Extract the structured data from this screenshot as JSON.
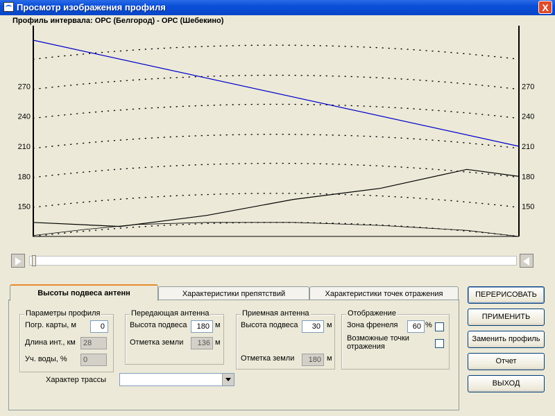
{
  "window": {
    "title": "Просмотр изображения профиля",
    "close_label": "X"
  },
  "profile_title": "Профиль интервала: ОРС (Белгород) - ОРС (Шебекино)",
  "chart_data": {
    "type": "line",
    "title": "Профиль интервала: ОРС (Белгород) - ОРС (Шебекино)",
    "xlabel": "",
    "ylabel": "",
    "xlim": [
      0,
      28
    ],
    "ylim": [
      120,
      325
    ],
    "x_ticks": [
      2,
      4,
      6,
      8,
      10,
      12,
      14,
      16,
      18,
      20,
      22,
      24,
      26
    ],
    "y_ticks": [
      150,
      180,
      210,
      240,
      270
    ],
    "series": [
      {
        "line_color": "#0000cc",
        "x": [
          0,
          28
        ],
        "y": [
          316,
          210
        ]
      },
      {
        "line_color": "#000000",
        "x": [
          0,
          5,
          10,
          15,
          20,
          25,
          28
        ],
        "y": [
          134,
          130,
          141,
          157,
          168,
          187,
          180
        ]
      },
      {
        "line_color": "#000000",
        "x": [
          0,
          3,
          6,
          10,
          15,
          20,
          25,
          28
        ],
        "y": [
          121,
          127,
          132,
          134,
          134,
          131,
          126,
          120
        ]
      }
    ],
    "earth_curve_offsets": [
      0,
      29,
      59,
      88,
      118,
      147,
      177
    ],
    "grid": "dotted"
  },
  "tabs": [
    {
      "label": "Высоты подвеса антенн",
      "active": true
    },
    {
      "label": "Характеристики препятствий",
      "active": false
    },
    {
      "label": "Характеристики точек отражения",
      "active": false
    }
  ],
  "profile_params": {
    "group_title": "Параметры профиля",
    "map_error_label": "Погр. карты, м",
    "map_error_value": "0",
    "length_label": "Длина инт., км",
    "length_value": "28",
    "water_label": "Уч. воды, %",
    "water_value": "0"
  },
  "tx_antenna": {
    "group_title": "Передающая антенна",
    "height_label": "Высота подвеса",
    "height_value": "180",
    "height_unit": "м",
    "ground_label": "Отметка земли",
    "ground_value": "136",
    "ground_unit": "м"
  },
  "rx_antenna": {
    "group_title": "Приемная антенна",
    "height_label": "Высота подвеса",
    "height_value": "30",
    "height_unit": "м",
    "ground_label": "Отметка земли",
    "ground_value": "180",
    "ground_unit": "м"
  },
  "display": {
    "group_title": "Отображение",
    "fresnel_label": "Зона френеля",
    "fresnel_value": "60",
    "fresnel_unit": "%",
    "reflection_label_1": "Возможные точки",
    "reflection_label_2": "отражения"
  },
  "route": {
    "label": "Характер трассы",
    "value": ""
  },
  "buttons": {
    "redraw": "ПЕРЕРИСОВАТЬ",
    "apply": "ПРИМЕНИТЬ",
    "replace": "Заменить профиль",
    "report": "Отчет",
    "exit": "ВЫХОД"
  }
}
